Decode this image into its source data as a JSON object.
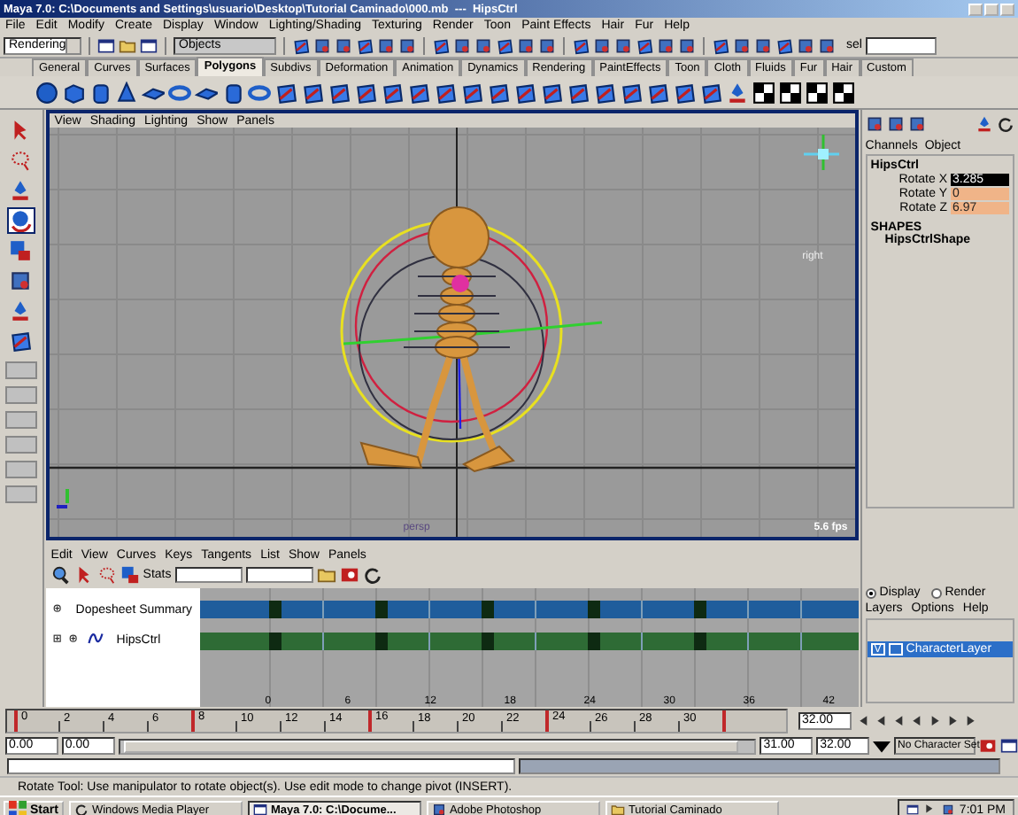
{
  "window": {
    "title": "Maya 7.0: C:\\Documents and Settings\\usuario\\Desktop\\Tutorial Caminado\\000.mb  ---  HipsCtrl"
  },
  "menu_bar": [
    "File",
    "Edit",
    "Modify",
    "Create",
    "Display",
    "Window",
    "Lighting/Shading",
    "Texturing",
    "Render",
    "Toon",
    "Paint Effects",
    "Hair",
    "Fur",
    "Help"
  ],
  "status_line": {
    "menu_set": "Rendering",
    "selection_mode": "Objects",
    "sel_label": "sel"
  },
  "shelf": {
    "tabs": [
      {
        "label": "General",
        "selected": false
      },
      {
        "label": "Curves",
        "selected": false
      },
      {
        "label": "Surfaces",
        "selected": false
      },
      {
        "label": "Polygons",
        "selected": true
      },
      {
        "label": "Subdivs",
        "selected": false
      },
      {
        "label": "Deformation",
        "selected": false
      },
      {
        "label": "Animation",
        "selected": false
      },
      {
        "label": "Dynamics",
        "selected": false
      },
      {
        "label": "Rendering",
        "selected": false
      },
      {
        "label": "PaintEffects",
        "selected": false
      },
      {
        "label": "Toon",
        "selected": false
      },
      {
        "label": "Cloth",
        "selected": false
      },
      {
        "label": "Fluids",
        "selected": false
      },
      {
        "label": "Fur",
        "selected": false
      },
      {
        "label": "Hair",
        "selected": false
      },
      {
        "label": "Custom",
        "selected": false
      }
    ]
  },
  "viewport": {
    "menu": [
      "View",
      "Shading",
      "Lighting",
      "Show",
      "Panels"
    ],
    "view_label": "right",
    "camera_label": "persp",
    "fps": "5.6 fps"
  },
  "dopesheet": {
    "menu": [
      "Edit",
      "View",
      "Curves",
      "Keys",
      "Tangents",
      "List",
      "Show",
      "Panels"
    ],
    "stats_label": "Stats",
    "rows": [
      {
        "kind": "summary",
        "label": "Dopesheet Summary",
        "keys": [
          true,
          false,
          true,
          false,
          true,
          false,
          true,
          false,
          true,
          false,
          false
        ]
      },
      {
        "kind": "object",
        "label": "HipsCtrl",
        "keys": [
          true,
          false,
          true,
          false,
          true,
          false,
          true,
          false,
          true,
          false,
          false
        ]
      }
    ],
    "ruler": [
      "0",
      "6",
      "12",
      "18",
      "24",
      "30",
      "36",
      "42"
    ]
  },
  "channel_box": {
    "menu": [
      "Channels",
      "Object"
    ],
    "node": "HipsCtrl",
    "attributes": [
      {
        "label": "Rotate X",
        "value": "3.285",
        "selected": true,
        "keyed": true
      },
      {
        "label": "Rotate Y",
        "value": "0",
        "selected": false,
        "keyed": true
      },
      {
        "label": "Rotate Z",
        "value": "6.97",
        "selected": false,
        "keyed": true
      }
    ],
    "shapes_header": "SHAPES",
    "shape": "HipsCtrlShape"
  },
  "layer_editor": {
    "modes": [
      {
        "label": "Display",
        "selected": true
      },
      {
        "label": "Render",
        "selected": false
      }
    ],
    "menu": [
      "Layers",
      "Options",
      "Help"
    ],
    "layers": [
      {
        "visibility": "V",
        "name": "CharacterLayer",
        "selected": true
      }
    ]
  },
  "time_slider": {
    "ticks": [
      {
        "label": "0",
        "key": true
      },
      {
        "label": "2",
        "key": false
      },
      {
        "label": "4",
        "key": false
      },
      {
        "label": "6",
        "key": false
      },
      {
        "label": "8",
        "key": true
      },
      {
        "label": "10",
        "key": false
      },
      {
        "label": "12",
        "key": false
      },
      {
        "label": "14",
        "key": false
      },
      {
        "label": "16",
        "key": true
      },
      {
        "label": "18",
        "key": false
      },
      {
        "label": "20",
        "key": false
      },
      {
        "label": "22",
        "key": false
      },
      {
        "label": "24",
        "key": true
      },
      {
        "label": "26",
        "key": false
      },
      {
        "label": "28",
        "key": false
      },
      {
        "label": "30",
        "key": false
      },
      {
        "key": true
      }
    ],
    "current_time": "32.00"
  },
  "range_slider": {
    "level": 0.97,
    "start": "0.00",
    "range_start": "0.00",
    "range_end": "31.00",
    "end": "32.00",
    "character_set": "No Character Set"
  },
  "help_line": "Rotate Tool: Use manipulator to rotate object(s). Use edit mode to change pivot (INSERT).",
  "taskbar": {
    "start": "Start",
    "tasks": [
      {
        "label": "Windows Media Player",
        "selected": false
      },
      {
        "label": "Maya 7.0: C:\\Docume...",
        "selected": true
      },
      {
        "label": "Adobe Photoshop",
        "selected": false
      },
      {
        "label": "Tutorial Caminado",
        "selected": false
      }
    ],
    "clock": "7:01 PM"
  }
}
